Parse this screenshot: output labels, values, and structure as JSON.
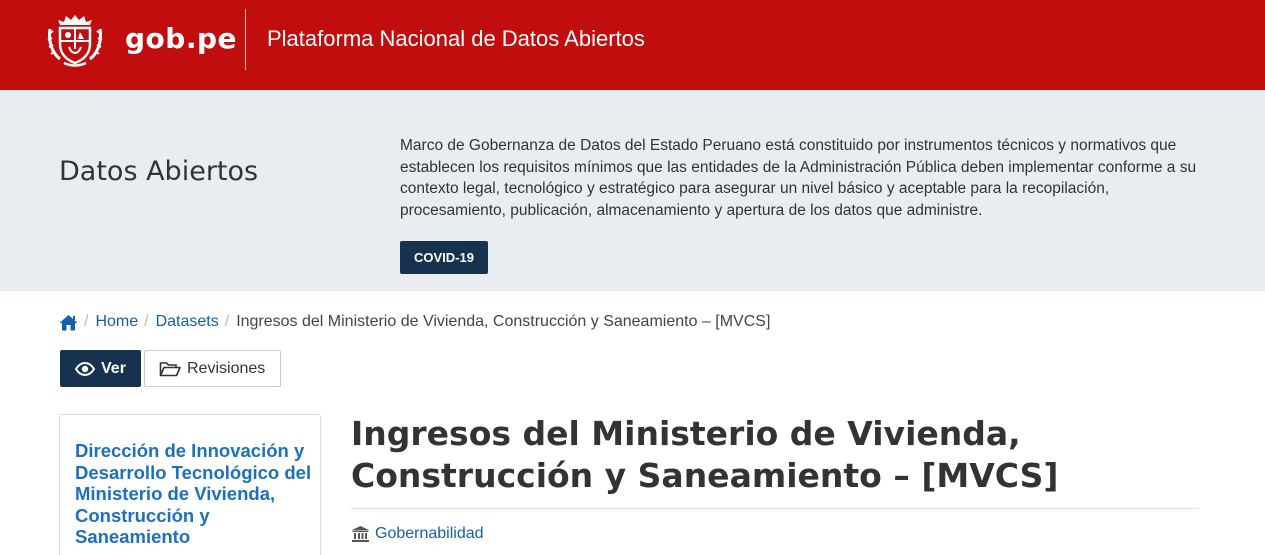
{
  "header": {
    "logo_text": "gob.pe",
    "platform_title": "Plataforma Nacional de Datos Abiertos",
    "emblem_icon": "peru-coat-of-arms-icon"
  },
  "hero": {
    "title": "Datos Abiertos",
    "description": "Marco de Gobernanza de Datos del Estado Peruano está constituido por instrumentos técnicos y normativos que establecen los requisitos mínimos que las entidades de la Administración Pública deben implementar conforme a su contexto legal, tecnológico y estratégico para asegurar un nivel básico y aceptable para la recopilación, procesamiento, publicación, almacenamiento y apertura de los datos que administre.",
    "covid_button": "COVID-19"
  },
  "breadcrumb": {
    "home_icon": "home-icon",
    "items": [
      "Home",
      "Datasets"
    ],
    "current": "Ingresos del Ministerio de Vivienda, Construcción y Saneamiento – [MVCS]"
  },
  "tabs": {
    "view": "Ver",
    "revisions": "Revisiones"
  },
  "sidebar": {
    "organization": "Dirección de Innovación y Desarrollo Tecnológico del Ministerio de Vivienda, Construcción y Saneamiento"
  },
  "dataset": {
    "title": "Ingresos del Ministerio de Vivienda, Construcción y Saneamiento – [MVCS]",
    "group": "Gobernabilidad"
  },
  "colors": {
    "header_red": "#c10d0d",
    "navy": "#17324f",
    "link_blue": "#1560a8",
    "hero_bg": "#e9ecf0"
  }
}
